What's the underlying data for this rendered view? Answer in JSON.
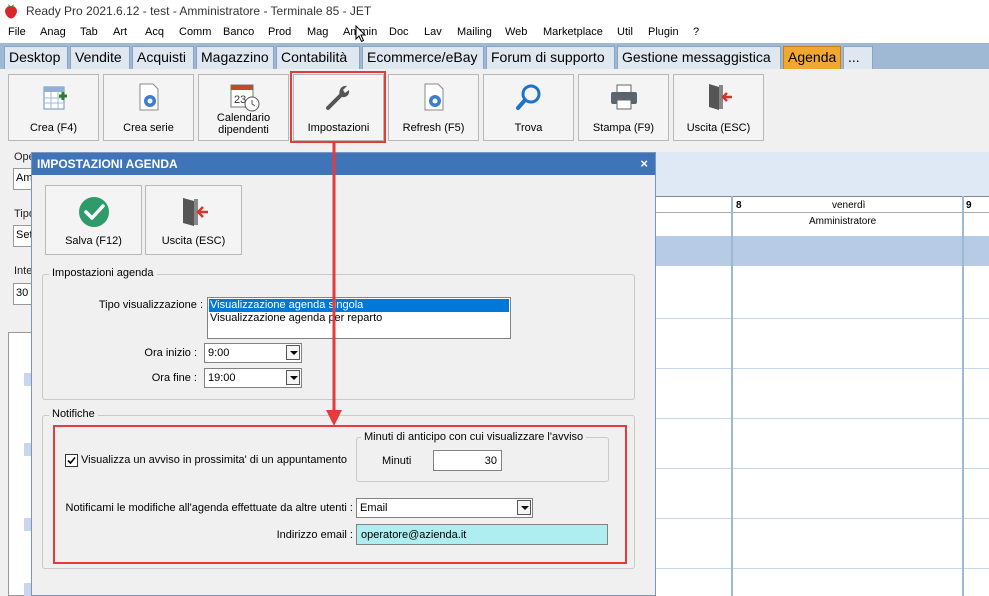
{
  "window": {
    "title": "Ready Pro 2021.6.12 - test - Amministratore - Terminale 85 - JET"
  },
  "menu": [
    "File",
    "Anag",
    "Tab",
    "Art",
    "Acq",
    "Comm",
    "Banco",
    "Prod",
    "Mag",
    "Ammin",
    "Doc",
    "Lav",
    "Mailing",
    "Web",
    "Marketplace",
    "Util",
    "Plugin",
    "?"
  ],
  "tabs": [
    {
      "label": "Desktop",
      "active": false
    },
    {
      "label": "Vendite",
      "active": false
    },
    {
      "label": "Acquisti",
      "active": false
    },
    {
      "label": "Magazzino",
      "active": false
    },
    {
      "label": "Contabilità",
      "active": false
    },
    {
      "label": "Ecommerce/eBay",
      "active": false
    },
    {
      "label": "Forum di supporto",
      "active": false
    },
    {
      "label": "Gestione messaggistica",
      "active": false
    },
    {
      "label": "Agenda",
      "active": true
    },
    {
      "label": "...",
      "active": false
    }
  ],
  "toolbar": {
    "crea": "Crea (F4)",
    "crea_serie": "Crea serie",
    "calendario_1": "Calendario",
    "calendario_2": "dipendenti",
    "impostazioni": "Impostazioni",
    "refresh": "Refresh (F5)",
    "trova": "Trova",
    "stampa": "Stampa (F9)",
    "uscita": "Uscita (ESC)"
  },
  "background": {
    "operatore_label": "Ope",
    "operatore_value": "Am",
    "tipo_label": "Tipo",
    "tipo_value": "Set",
    "intervallo_label": "Inte",
    "intervallo_value": "30",
    "calendar": {
      "day_num_1": "8",
      "day_name": "venerdì",
      "day_num_2": "9",
      "operator": "Amministratore"
    }
  },
  "dialog": {
    "title": "IMPOSTAZIONI AGENDA",
    "close": "×",
    "salva": "Salva (F12)",
    "uscita": "Uscita (ESC)",
    "agenda_group": "Impostazioni agenda",
    "tipo_label": "Tipo visualizzazione :",
    "tipo_options": [
      "Visualizzazione agenda singola",
      "Visualizzazione agenda per reparto"
    ],
    "tipo_selected": 0,
    "ora_inizio_label": "Ora inizio :",
    "ora_inizio_value": "9:00",
    "ora_fine_label": "Ora fine :",
    "ora_fine_value": "19:00",
    "notifiche_group": "Notifiche",
    "avviso_label": "Visualizza un avviso in prossimita' di un appuntamento",
    "avviso_checked": true,
    "minuti_group": "Minuti di anticipo con cui visualizzare l'avviso",
    "minuti_label": "Minuti",
    "minuti_value": "30",
    "notificami_label": "Notificami le modifiche all'agenda effettuate da altre utenti :",
    "notificami_value": "Email",
    "email_label": "Indirizzo email :",
    "email_value": "operatore@azienda.it"
  },
  "colors": {
    "accent_tab": "#f0a830",
    "dialog_title": "#3f74b8",
    "highlight": "#e53b3b",
    "email_field": "#aeeef0"
  }
}
